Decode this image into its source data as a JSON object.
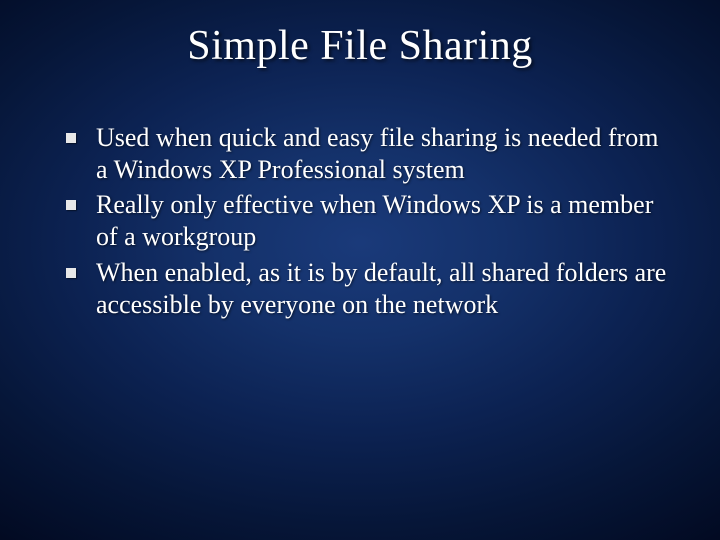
{
  "slide": {
    "title": "Simple File Sharing",
    "bullets": [
      "Used when quick and easy file sharing is needed from a Windows XP Professional system",
      "Really only effective when Windows XP is a member of a workgroup",
      "When enabled, as it is by default, all shared folders are accessible by everyone on the network"
    ]
  }
}
